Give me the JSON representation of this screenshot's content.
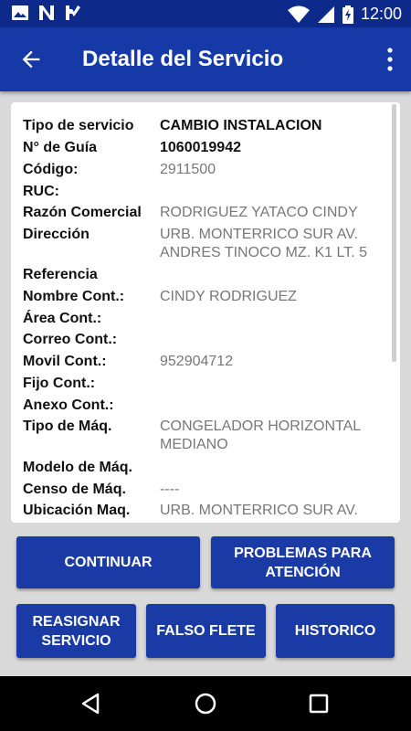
{
  "status_bar": {
    "time": "12:00",
    "left_icons": [
      "image-icon",
      "n-notification-icon",
      "flag-check-icon"
    ],
    "right_icons": [
      "wifi-icon",
      "signal-icon",
      "battery-charging-icon"
    ]
  },
  "app_bar": {
    "title": "Detalle del Servicio",
    "back_icon": "arrow-back-icon",
    "menu_icon": "more-vert-icon"
  },
  "details": [
    {
      "label": "Tipo de servicio",
      "value": "CAMBIO INSTALACION",
      "emphasis": true
    },
    {
      "label": "N° de Guía",
      "value": "1060019942",
      "emphasis": true
    },
    {
      "label": "Código:",
      "value": "2911500"
    },
    {
      "label": "RUC:",
      "value": ""
    },
    {
      "label": "Razón Comercial",
      "value": "RODRIGUEZ YATACO CINDY"
    },
    {
      "label": "Dirección",
      "value": "URB. MONTERRICO SUR AV. ANDRES TINOCO MZ. K1 LT. 5"
    },
    {
      "label": "Referencia",
      "value": ""
    },
    {
      "label": "Nombre Cont.:",
      "value": "CINDY RODRIGUEZ"
    },
    {
      "label": "Área Cont.:",
      "value": ""
    },
    {
      "label": "Correo Cont.:",
      "value": ""
    },
    {
      "label": "Movil Cont.:",
      "value": "952904712"
    },
    {
      "label": "Fijo Cont.:",
      "value": ""
    },
    {
      "label": "Anexo Cont.:",
      "value": ""
    },
    {
      "label": "Tipo de Máq.",
      "value": "CONGELADOR HORIZONTAL MEDIANO"
    },
    {
      "label": "Modelo de Máq.",
      "value": ""
    },
    {
      "label": "Censo de Máq.",
      "value": "----"
    },
    {
      "label": "Ubicación Maq.",
      "value": "URB. MONTERRICO SUR AV."
    }
  ],
  "buttons": {
    "continuar": "CONTINUAR",
    "problemas": "PROBLEMAS PARA ATENCIÓN",
    "reasignar": "REASIGNAR SERVICIO",
    "falso_flete": "FALSO FLETE",
    "historico": "HISTORICO"
  },
  "colors": {
    "status_bar": "#0d2a8a",
    "app_bar": "#153aa8",
    "button": "#1a3aa6",
    "background": "#d9d9d9"
  },
  "nav_bar": {
    "icons": [
      "back-triangle-icon",
      "home-circle-icon",
      "recents-square-icon"
    ]
  }
}
